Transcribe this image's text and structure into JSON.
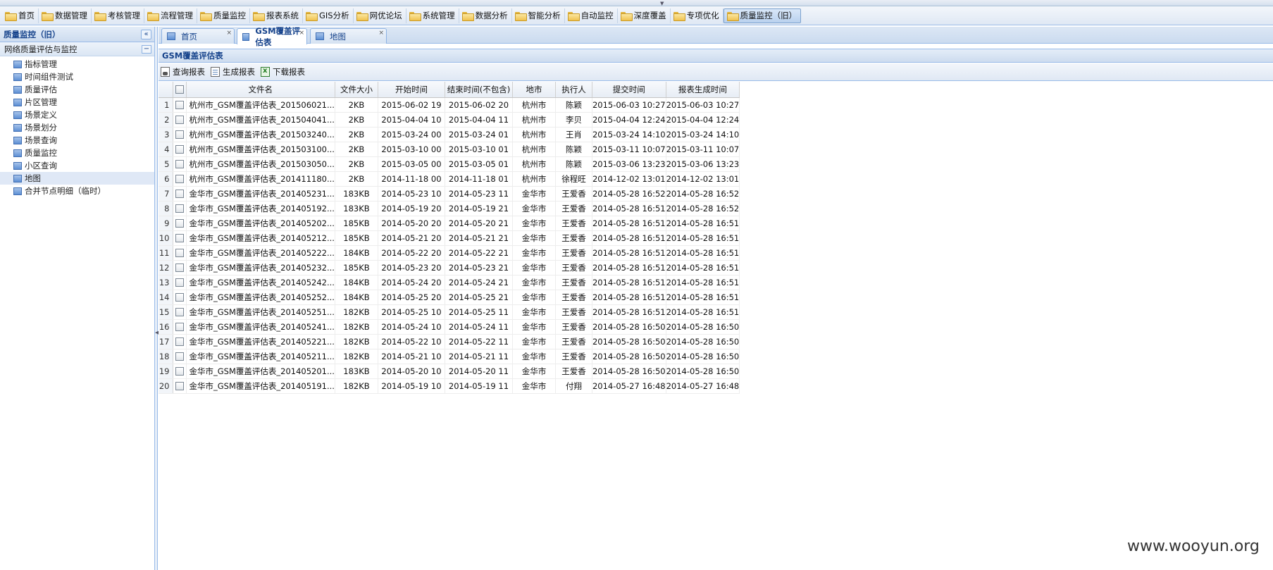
{
  "menubar": {
    "items": [
      "首页",
      "数据管理",
      "考核管理",
      "流程管理",
      "质量监控",
      "报表系统",
      "GIS分析",
      "网优论坛",
      "系统管理",
      "数据分析",
      "智能分析",
      "自动监控",
      "深度覆盖",
      "专项优化",
      "质量监控（旧）"
    ],
    "active_index": 14
  },
  "sidebar": {
    "title": "质量监控（旧）",
    "collapse_glyph": "«",
    "section_title": "网络质量评估与监控",
    "section_toggle": "−",
    "items": [
      "指标管理",
      "时间组件测试",
      "质量评估",
      "片区管理",
      "场景定义",
      "场景划分",
      "场景查询",
      "质量监控",
      "小区查询",
      "地图",
      "合并节点明细（临时）"
    ],
    "selected_index": 9
  },
  "tabs": {
    "items": [
      {
        "label": "首页",
        "close": "×"
      },
      {
        "label": "GSM覆盖评估表",
        "close": "×"
      },
      {
        "label": "地图",
        "close": "×"
      }
    ],
    "active_index": 1
  },
  "panel": {
    "title": "GSM覆盖评估表"
  },
  "toolbar": {
    "query_label": "查询报表",
    "generate_label": "生成报表",
    "download_label": "下载报表"
  },
  "grid": {
    "columns": [
      "文件名",
      "文件大小",
      "开始时间",
      "结束时间(不包含)",
      "地市",
      "执行人",
      "提交时间",
      "报表生成时间"
    ],
    "rows": [
      [
        "1",
        "杭州市_GSM覆盖评估表_201506021...",
        "2KB",
        "2015-06-02 19",
        "2015-06-02 20",
        "杭州市",
        "陈颖",
        "2015-06-03 10:27",
        "2015-06-03 10:27"
      ],
      [
        "2",
        "杭州市_GSM覆盖评估表_201504041...",
        "2KB",
        "2015-04-04 10",
        "2015-04-04 11",
        "杭州市",
        "李贝",
        "2015-04-04 12:24",
        "2015-04-04 12:24"
      ],
      [
        "3",
        "杭州市_GSM覆盖评估表_201503240...",
        "2KB",
        "2015-03-24 00",
        "2015-03-24 01",
        "杭州市",
        "王肖",
        "2015-03-24 14:10",
        "2015-03-24 14:10"
      ],
      [
        "4",
        "杭州市_GSM覆盖评估表_201503100...",
        "2KB",
        "2015-03-10 00",
        "2015-03-10 01",
        "杭州市",
        "陈颖",
        "2015-03-11 10:07",
        "2015-03-11 10:07"
      ],
      [
        "5",
        "杭州市_GSM覆盖评估表_201503050...",
        "2KB",
        "2015-03-05 00",
        "2015-03-05 01",
        "杭州市",
        "陈颖",
        "2015-03-06 13:23",
        "2015-03-06 13:23"
      ],
      [
        "6",
        "杭州市_GSM覆盖评估表_201411180...",
        "2KB",
        "2014-11-18 00",
        "2014-11-18 01",
        "杭州市",
        "徐程旺",
        "2014-12-02 13:01",
        "2014-12-02 13:01"
      ],
      [
        "7",
        "金华市_GSM覆盖评估表_201405231...",
        "183KB",
        "2014-05-23 10",
        "2014-05-23 11",
        "金华市",
        "王爱香",
        "2014-05-28 16:52",
        "2014-05-28 16:52"
      ],
      [
        "8",
        "金华市_GSM覆盖评估表_201405192...",
        "183KB",
        "2014-05-19 20",
        "2014-05-19 21",
        "金华市",
        "王爱香",
        "2014-05-28 16:51",
        "2014-05-28 16:52"
      ],
      [
        "9",
        "金华市_GSM覆盖评估表_201405202...",
        "185KB",
        "2014-05-20 20",
        "2014-05-20 21",
        "金华市",
        "王爱香",
        "2014-05-28 16:51",
        "2014-05-28 16:51"
      ],
      [
        "10",
        "金华市_GSM覆盖评估表_201405212...",
        "185KB",
        "2014-05-21 20",
        "2014-05-21 21",
        "金华市",
        "王爱香",
        "2014-05-28 16:51",
        "2014-05-28 16:51"
      ],
      [
        "11",
        "金华市_GSM覆盖评估表_201405222...",
        "184KB",
        "2014-05-22 20",
        "2014-05-22 21",
        "金华市",
        "王爱香",
        "2014-05-28 16:51",
        "2014-05-28 16:51"
      ],
      [
        "12",
        "金华市_GSM覆盖评估表_201405232...",
        "185KB",
        "2014-05-23 20",
        "2014-05-23 21",
        "金华市",
        "王爱香",
        "2014-05-28 16:51",
        "2014-05-28 16:51"
      ],
      [
        "13",
        "金华市_GSM覆盖评估表_201405242...",
        "184KB",
        "2014-05-24 20",
        "2014-05-24 21",
        "金华市",
        "王爱香",
        "2014-05-28 16:51",
        "2014-05-28 16:51"
      ],
      [
        "14",
        "金华市_GSM覆盖评估表_201405252...",
        "184KB",
        "2014-05-25 20",
        "2014-05-25 21",
        "金华市",
        "王爱香",
        "2014-05-28 16:51",
        "2014-05-28 16:51"
      ],
      [
        "15",
        "金华市_GSM覆盖评估表_201405251...",
        "182KB",
        "2014-05-25 10",
        "2014-05-25 11",
        "金华市",
        "王爱香",
        "2014-05-28 16:51",
        "2014-05-28 16:51"
      ],
      [
        "16",
        "金华市_GSM覆盖评估表_201405241...",
        "182KB",
        "2014-05-24 10",
        "2014-05-24 11",
        "金华市",
        "王爱香",
        "2014-05-28 16:50",
        "2014-05-28 16:50"
      ],
      [
        "17",
        "金华市_GSM覆盖评估表_201405221...",
        "182KB",
        "2014-05-22 10",
        "2014-05-22 11",
        "金华市",
        "王爱香",
        "2014-05-28 16:50",
        "2014-05-28 16:50"
      ],
      [
        "18",
        "金华市_GSM覆盖评估表_201405211...",
        "182KB",
        "2014-05-21 10",
        "2014-05-21 11",
        "金华市",
        "王爱香",
        "2014-05-28 16:50",
        "2014-05-28 16:50"
      ],
      [
        "19",
        "金华市_GSM覆盖评估表_201405201...",
        "183KB",
        "2014-05-20 10",
        "2014-05-20 11",
        "金华市",
        "王爱香",
        "2014-05-28 16:50",
        "2014-05-28 16:50"
      ],
      [
        "20",
        "金华市_GSM覆盖评估表_201405191...",
        "182KB",
        "2014-05-19 10",
        "2014-05-19 11",
        "金华市",
        "付翔",
        "2014-05-27 16:48",
        "2014-05-27 16:48"
      ]
    ]
  },
  "watermark": "www.wooyun.org",
  "colors": {
    "accent": "#15428b",
    "border": "#99bbe8",
    "header_bg": "#dfe8f6"
  }
}
